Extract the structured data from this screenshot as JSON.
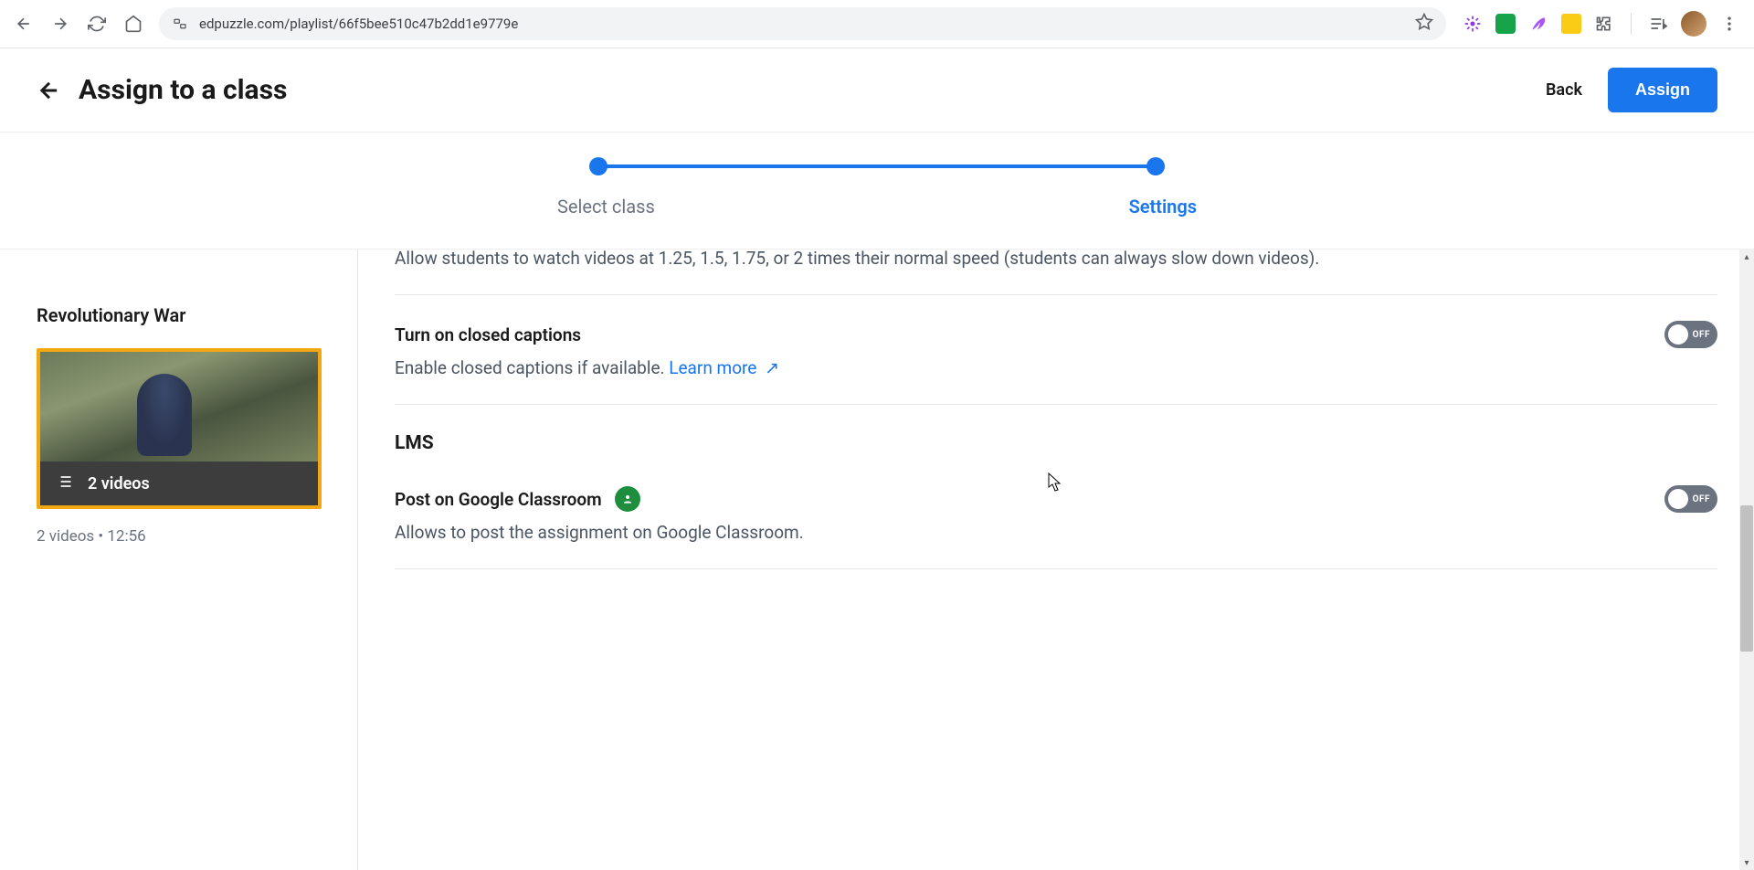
{
  "browser": {
    "url": "edpuzzle.com/playlist/66f5bee510c47b2dd1e9779e"
  },
  "header": {
    "title": "Assign to a class",
    "back_label": "Back",
    "assign_label": "Assign"
  },
  "progress": {
    "step1": "Select class",
    "step2": "Settings"
  },
  "sidebar": {
    "playlist_title": "Revolutionary War",
    "video_count_label": "2 videos",
    "meta": "2 videos • 12:56"
  },
  "settings": {
    "speed_desc": "Allow students to watch videos at 1.25, 1.5, 1.75, or 2 times their normal speed (students can always slow down videos).",
    "cc_title": "Turn on closed captions",
    "cc_desc": "Enable closed captions if available. ",
    "cc_learn": "Learn more",
    "lms_heading": "LMS",
    "gc_title": "Post on Google Classroom",
    "gc_desc": "Allows to post the assignment on Google Classroom.",
    "toggle_off": "OFF"
  }
}
